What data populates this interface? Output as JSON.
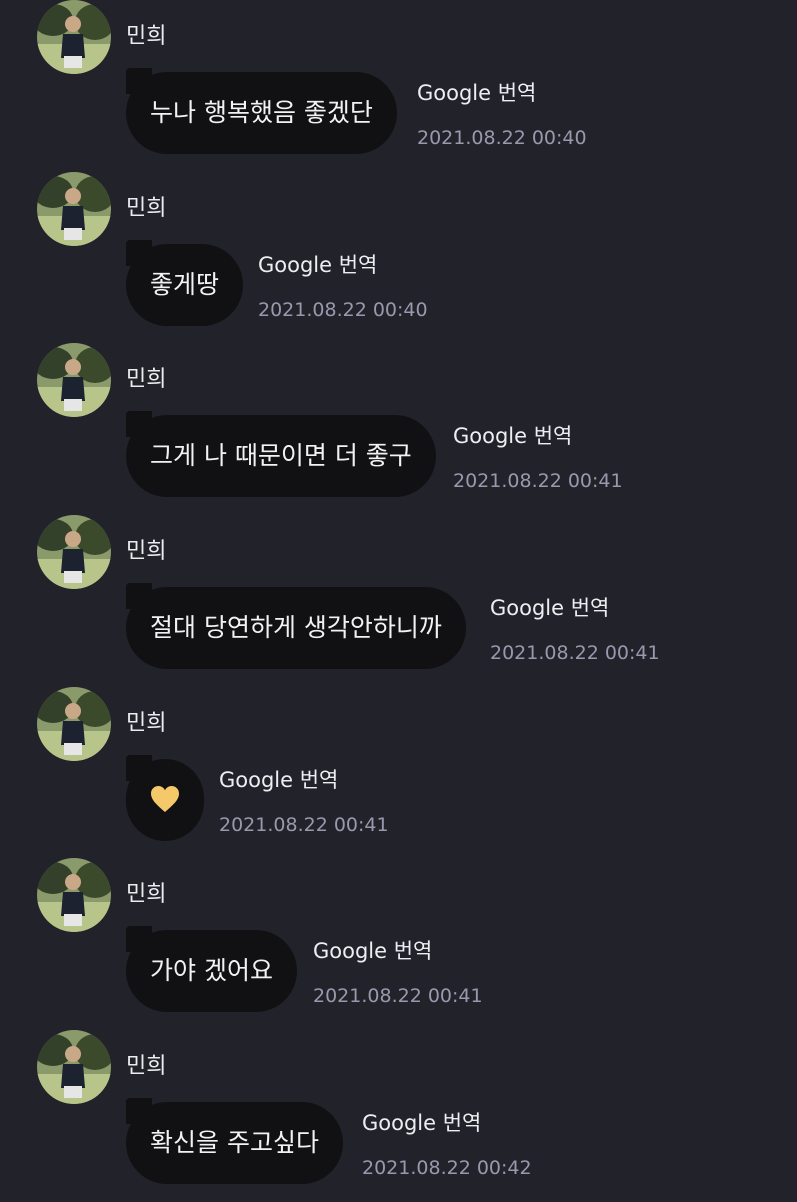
{
  "messages": [
    {
      "sender": "민희",
      "text": "누나 행복했음 좋겠단",
      "translate": "Google 번역",
      "time": "2021.08.22 00:40"
    },
    {
      "sender": "민희",
      "text": "좋게땅",
      "translate": "Google 번역",
      "time": "2021.08.22 00:40"
    },
    {
      "sender": "민희",
      "text": "그게 나 때문이면 더 좋구",
      "translate": "Google 번역",
      "time": "2021.08.22 00:41"
    },
    {
      "sender": "민희",
      "text": "절대 당연하게 생각안하니까",
      "translate": "Google 번역",
      "time": "2021.08.22 00:41"
    },
    {
      "sender": "민희",
      "emoji": "heart-icon",
      "translate": "Google 번역",
      "time": "2021.08.22 00:41"
    },
    {
      "sender": "민희",
      "text": "가야 겠어요",
      "translate": "Google 번역",
      "time": "2021.08.22 00:41"
    },
    {
      "sender": "민희",
      "text": "확신을 주고싶다",
      "translate": "Google 번역",
      "time": "2021.08.22 00:42"
    }
  ],
  "colors": {
    "background": "#22222a",
    "bubble": "#111114",
    "timestamp": "#9a98ad",
    "heart": "#f5c96a"
  }
}
